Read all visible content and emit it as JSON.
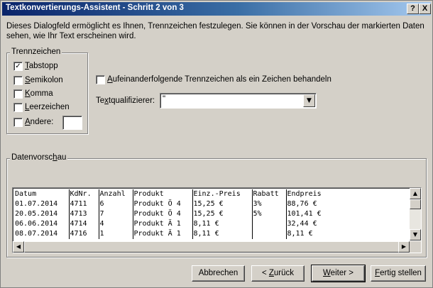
{
  "window": {
    "title": "Textkonvertierungs-Assistent - Schritt 2 von 3",
    "help_label": "?",
    "close_label": "X"
  },
  "intro": "Dieses Dialogfeld ermöglicht es Ihnen, Trennzeichen festzulegen. Sie können in der Vorschau der markierten Daten sehen, wie Ihr Text erscheinen wird.",
  "delimiters": {
    "group_title": "Trennzeichen",
    "tab": {
      "pre": "",
      "hot": "T",
      "post": "abstopp",
      "checked": true
    },
    "semicolon": {
      "pre": "",
      "hot": "S",
      "post": "emikolon",
      "checked": false
    },
    "comma": {
      "pre": "",
      "hot": "K",
      "post": "omma",
      "checked": false
    },
    "space": {
      "pre": "",
      "hot": "L",
      "post": "eerzeichen",
      "checked": false
    },
    "other": {
      "pre": "",
      "hot": "A",
      "post": "ndere:",
      "checked": false,
      "value": ""
    }
  },
  "consecutive": {
    "pre": "",
    "hot": "A",
    "post": "ufeinanderfolgende Trennzeichen als ein Zeichen behandeln",
    "checked": false
  },
  "qualifier": {
    "pre": "Te",
    "hot": "x",
    "post": "tqualifizierer:",
    "value": "\""
  },
  "preview": {
    "group_pre": "Datenvorsc",
    "group_hot": "h",
    "group_post": "au",
    "rows": [
      [
        "Datum",
        "KdNr.",
        "Anzahl",
        "Produkt",
        "Einz.-Preis",
        "Rabatt",
        "Endpreis"
      ],
      [
        "01.07.2014",
        "4711",
        "6",
        "Produkt Ö 4",
        "15,25 €",
        "3%",
        "88,76 €"
      ],
      [
        "20.05.2014",
        "4713",
        "7",
        "Produkt Ö 4",
        "15,25 €",
        "5%",
        "101,41 €"
      ],
      [
        "06.06.2014",
        "4714",
        "4",
        "Produkt Ä 1",
        "8,11 €",
        "",
        "32,44 €"
      ],
      [
        "08.07.2014",
        "4716",
        "1",
        "Produkt Ä 1",
        "8,11 €",
        "",
        "8,11 €"
      ]
    ]
  },
  "buttons": {
    "cancel": "Abbrechen",
    "back": {
      "pre": "< ",
      "hot": "Z",
      "post": "urück"
    },
    "next": {
      "pre": "",
      "hot": "W",
      "post": "eiter >"
    },
    "finish": {
      "pre": "",
      "hot": "F",
      "post": "ertig stellen"
    }
  }
}
